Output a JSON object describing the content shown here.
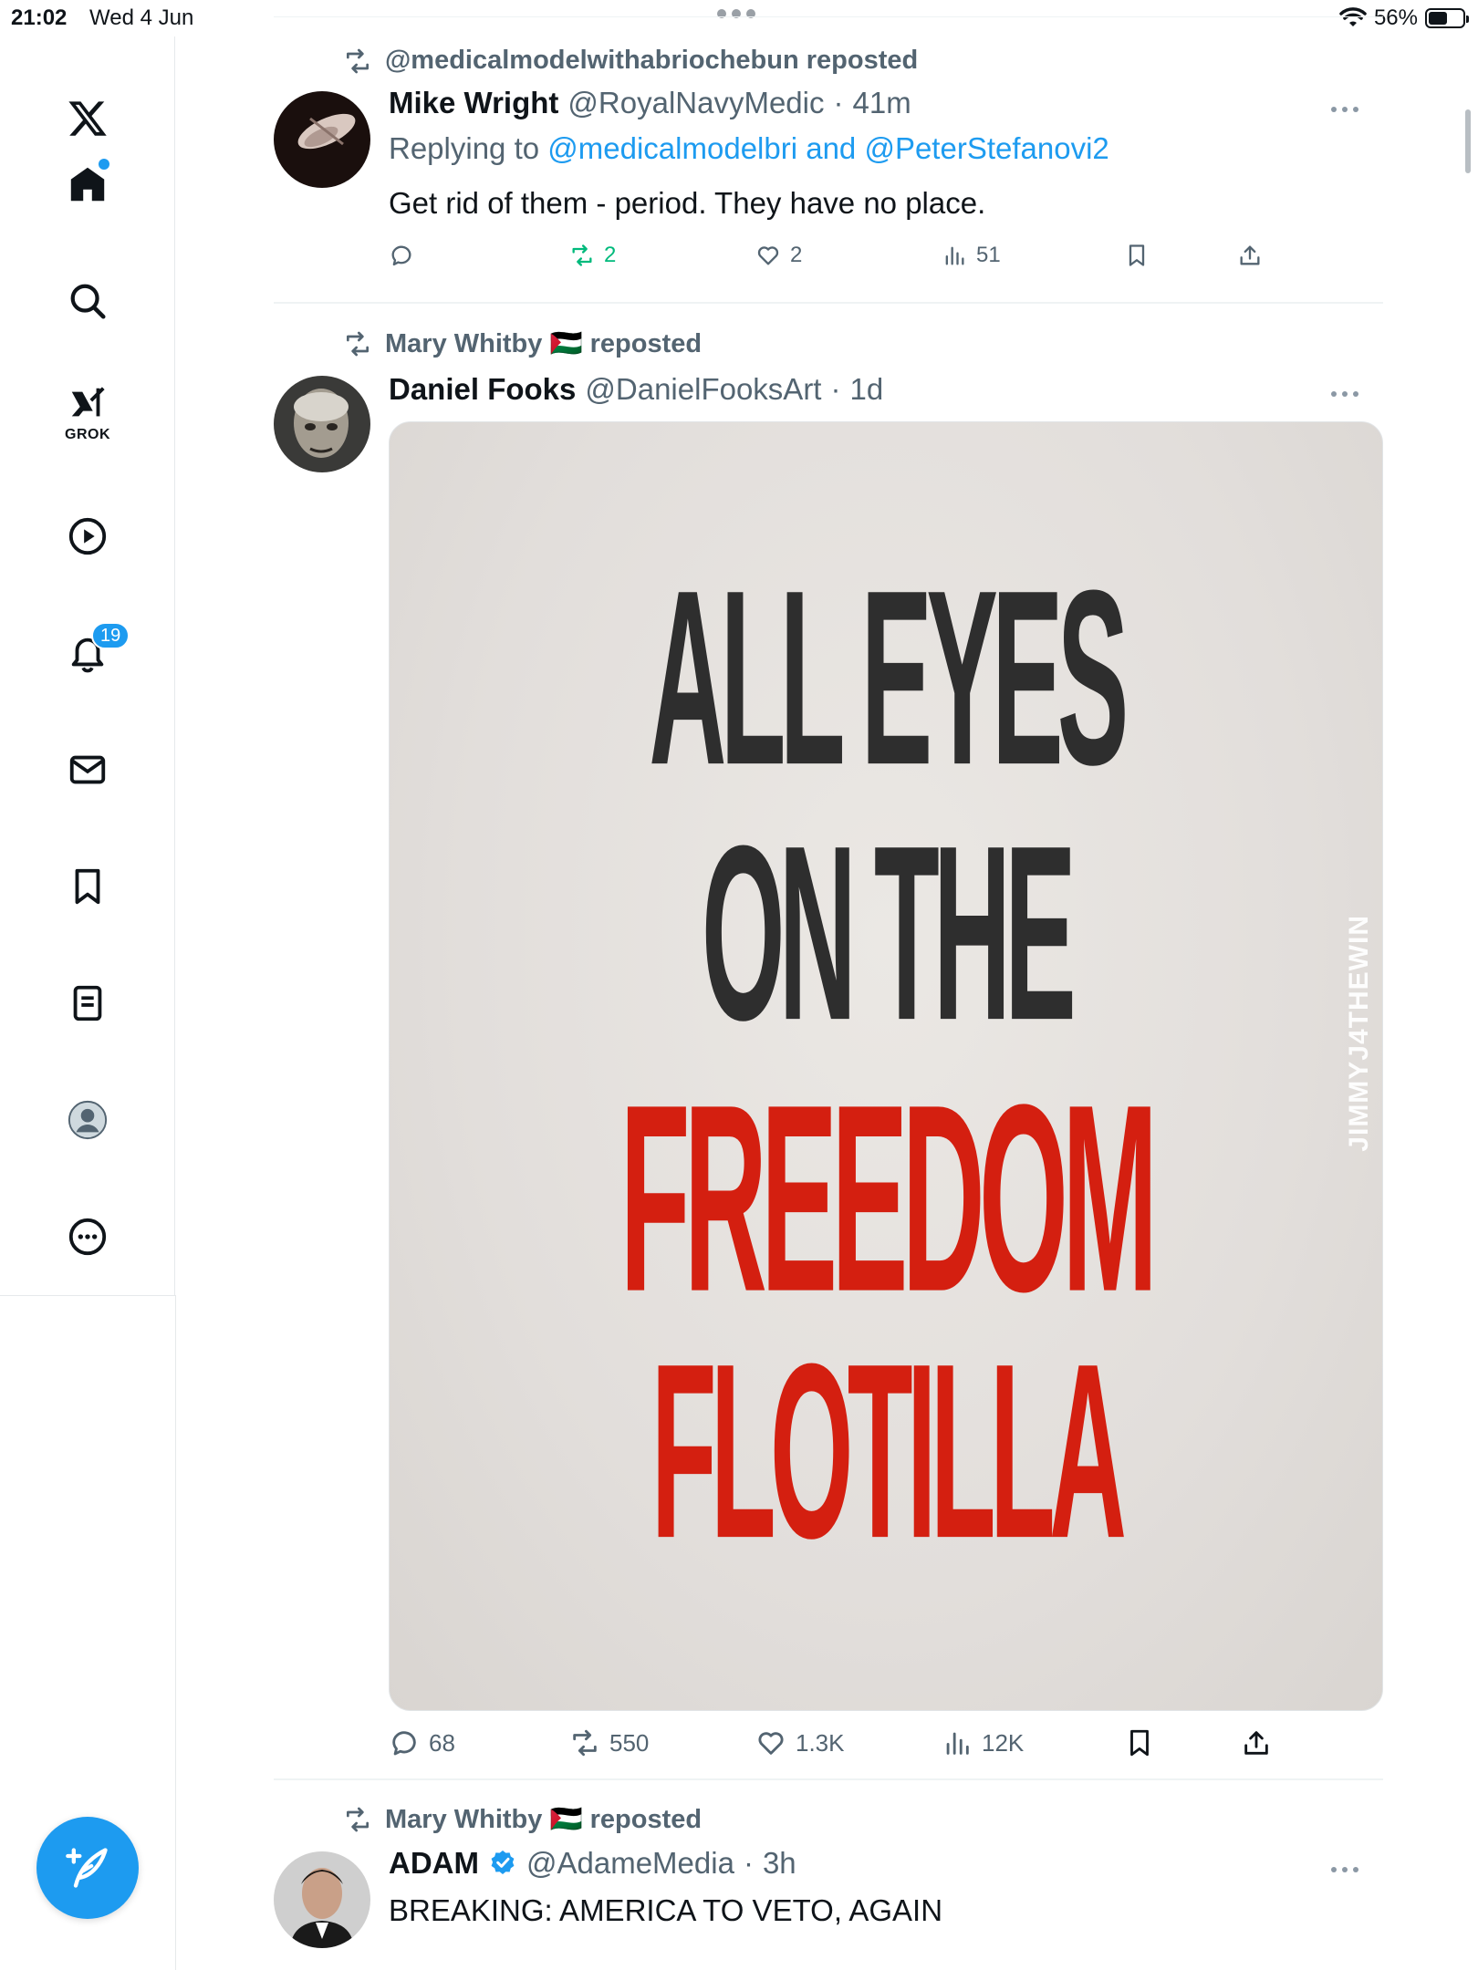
{
  "status_bar": {
    "time": "21:02",
    "date": "Wed 4 Jun",
    "battery_percent": "56%",
    "battery_level": 0.56
  },
  "sidebar": {
    "items": [
      {
        "name": "x-logo",
        "icon": "x-logo-icon"
      },
      {
        "name": "home",
        "icon": "home-icon",
        "active": true
      },
      {
        "name": "explore",
        "icon": "search-icon"
      },
      {
        "name": "grok",
        "icon": "grok-icon",
        "label": "GROK"
      },
      {
        "name": "videos",
        "icon": "play-icon"
      },
      {
        "name": "notifications",
        "icon": "bell-icon",
        "badge": "19"
      },
      {
        "name": "messages",
        "icon": "mail-icon"
      },
      {
        "name": "bookmarks",
        "icon": "bookmark-icon"
      },
      {
        "name": "lists",
        "icon": "list-icon"
      },
      {
        "name": "profile",
        "icon": "profile-icon"
      },
      {
        "name": "more",
        "icon": "more-circle-icon"
      }
    ],
    "compose": {
      "icon": "compose-feather-icon"
    }
  },
  "colors": {
    "accent": "#1d9bf0",
    "repost_green": "#00ba7c",
    "secondary_text": "#536471",
    "poster_red": "#d41f10",
    "poster_dark": "#2e2e2e"
  },
  "posts": [
    {
      "repost_by": "@medicalmodelwithabriochebun reposted",
      "display_name": "Mike Wright",
      "handle": "@RoyalNavyMedic",
      "separator": "·",
      "time": "41m",
      "reply_prefix": "Replying to",
      "reply_mentions": "@medicalmodelbri and @PeterStefanovi2",
      "text": "Get rid of them - period. They have no place.",
      "stats": {
        "replies": "",
        "reposts": "2",
        "likes": "2",
        "views": "51"
      }
    },
    {
      "repost_by": "Mary Whitby 🇵🇸 reposted",
      "display_name": "Daniel Fooks",
      "handle": "@DanielFooksArt",
      "separator": "·",
      "time": "1d",
      "media": {
        "lines": [
          "ALL EYES",
          "ON THE",
          "FREEDOM",
          "FLOTILLA"
        ],
        "watermark": "JIMMYJ4THEWIN"
      },
      "stats": {
        "replies": "68",
        "reposts": "550",
        "likes": "1.3K",
        "views": "12K"
      }
    },
    {
      "repost_by": "Mary Whitby 🇵🇸 reposted",
      "display_name": "ADAM",
      "handle": "@AdameMedia",
      "separator": "·",
      "time": "3h",
      "verified": true,
      "text": "BREAKING: AMERICA TO VETO, AGAIN"
    }
  ]
}
